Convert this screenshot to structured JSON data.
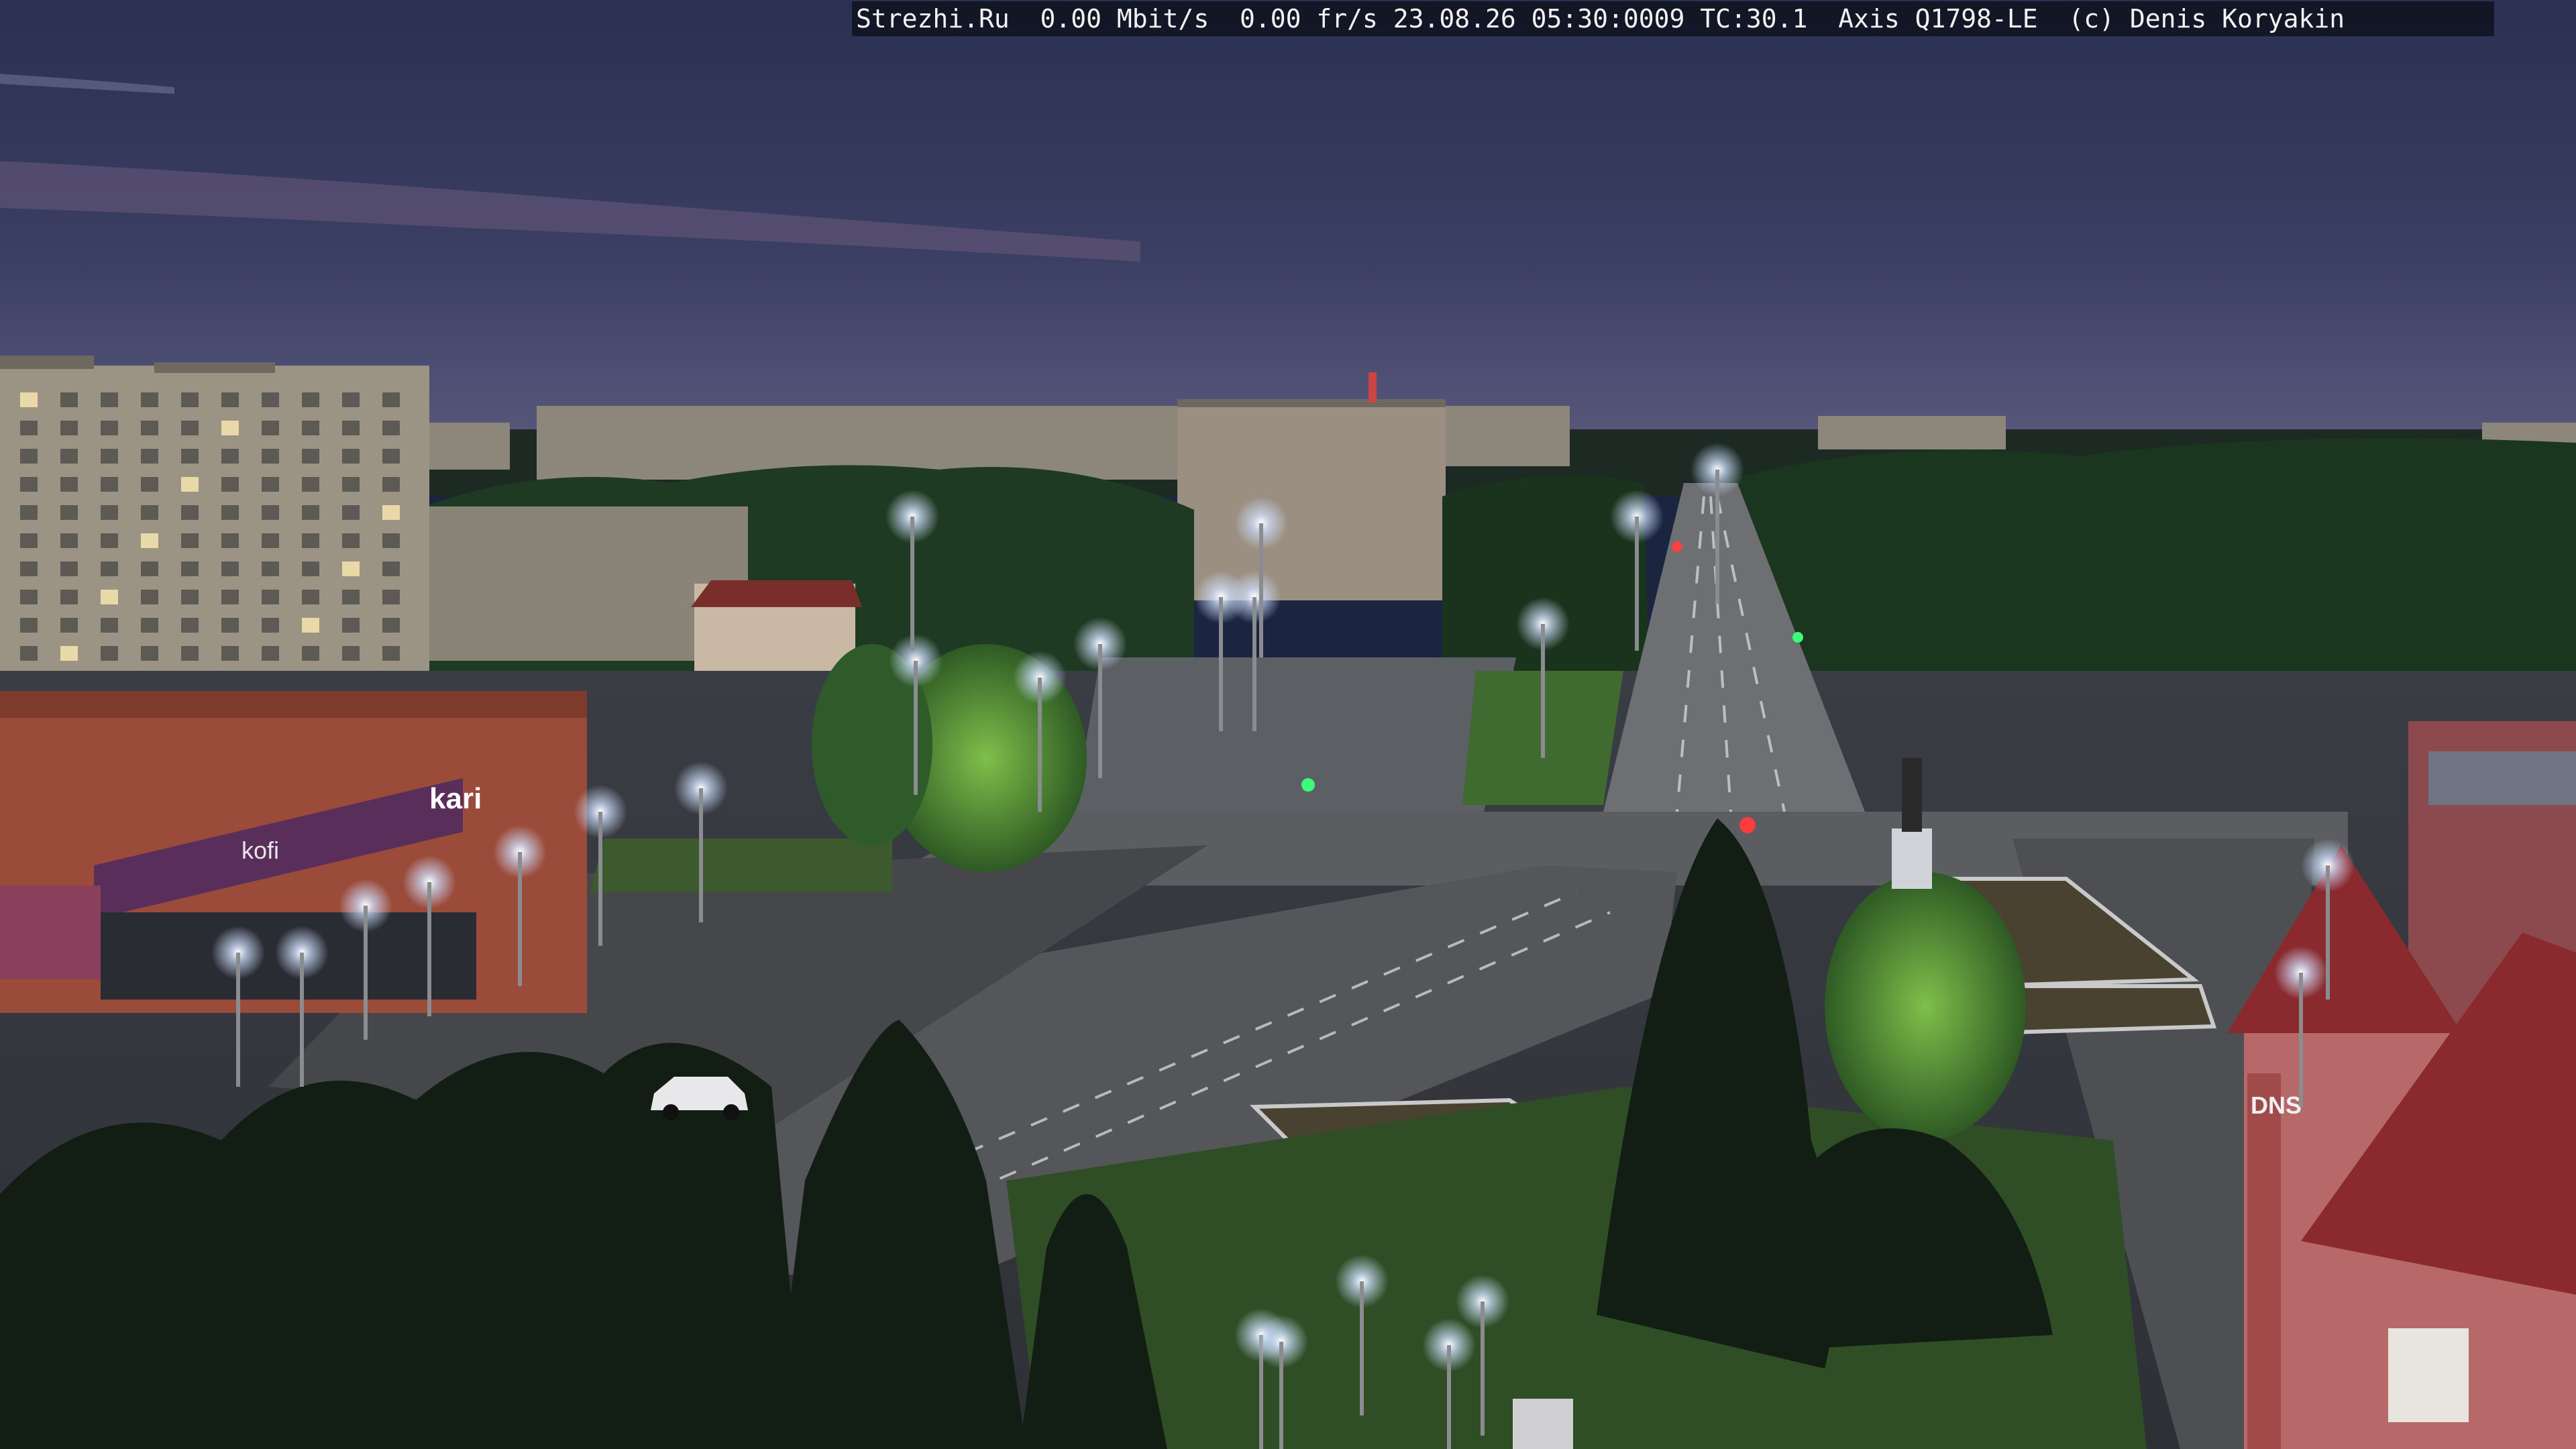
{
  "overlay": {
    "text": "Strezhi.Ru  0.00 Mbit/s  0.00 fr/s 23.08.26 05:30:0009 TC:30.1  Axis Q1798-LE  (c) Denis Koryakin"
  },
  "signs": {
    "kari": "kari",
    "kofi": "kofi",
    "dns": "DNS"
  },
  "colors": {
    "sky_top": "#2d3456",
    "sky_mid": "#3a3f63",
    "sky_horizon": "#5a5a7e",
    "street_light": "#e8f0ff",
    "foliage": "#1d3a1f",
    "road": "#4b4d52",
    "building_brick": "#9a4a3a",
    "building_panel": "#8a8478"
  }
}
